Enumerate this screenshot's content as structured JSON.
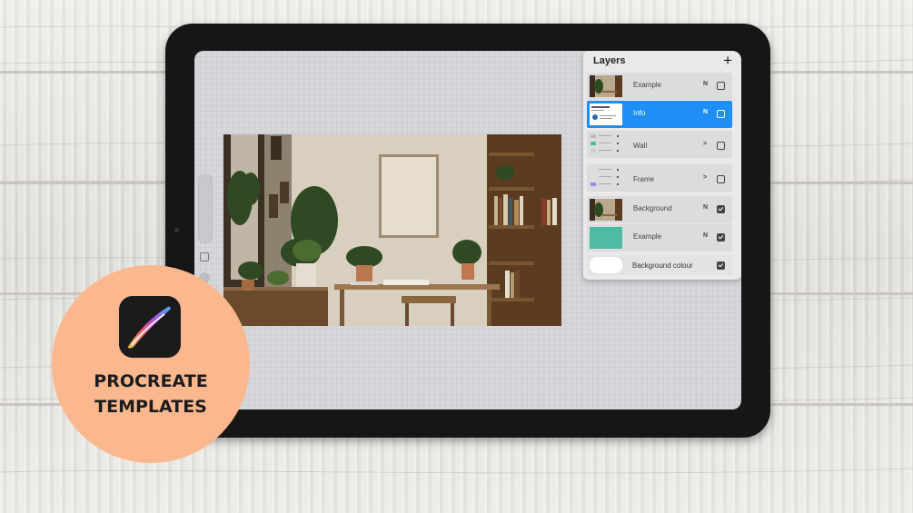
{
  "layers_panel": {
    "title": "Layers",
    "add_icon": "plus-icon",
    "layers": [
      {
        "name": "Example",
        "mode": "N",
        "visible": false,
        "selected": false
      },
      {
        "name": "Info",
        "mode": "N",
        "visible": false,
        "selected": true
      },
      {
        "name": "Wall",
        "mode": ">",
        "visible": false,
        "selected": false
      },
      {
        "name": "Frame",
        "mode": ">",
        "visible": false,
        "selected": false
      },
      {
        "name": "Background",
        "mode": "N",
        "visible": true,
        "selected": false
      },
      {
        "name": "Example",
        "mode": "N",
        "visible": true,
        "selected": false
      }
    ],
    "background_colour": {
      "name": "Background colour",
      "visible": true
    }
  },
  "badge": {
    "line1": "PROCREATE",
    "line2": "TEMPLATES",
    "app_icon": "procreate-brush-icon"
  },
  "colors": {
    "selected_layer": "#1e8ff5",
    "badge": "#fbb88f",
    "teal_thumb": "#4fbba2"
  }
}
